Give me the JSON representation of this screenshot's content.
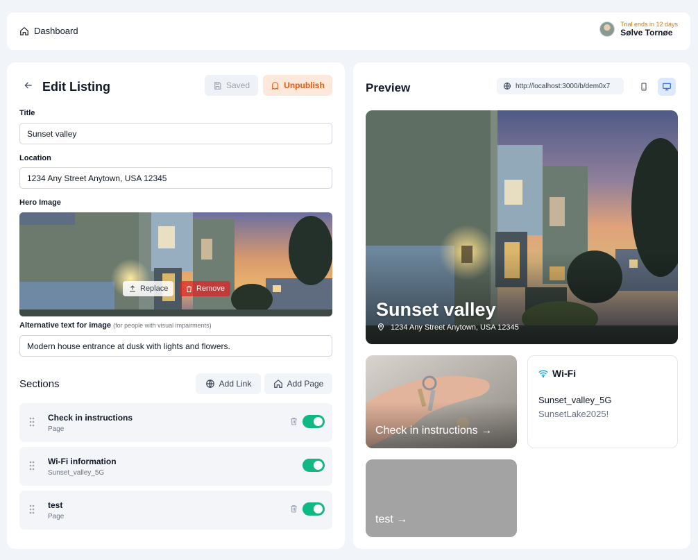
{
  "topbar": {
    "dashboard_label": "Dashboard",
    "trial_text": "Trial ends in 12 days",
    "user_name": "Sølve Tornøe"
  },
  "editor": {
    "title": "Edit Listing",
    "saved_label": "Saved",
    "unpublish_label": "Unpublish",
    "title_label": "Title",
    "title_value": "Sunset valley",
    "location_label": "Location",
    "location_value": "1234 Any Street Anytown, USA 12345",
    "hero_label": "Hero Image",
    "replace_label": "Replace",
    "remove_label": "Remove",
    "alt_label": "Alternative text for image",
    "alt_hint": "(for people with visual impairments)",
    "alt_value": "Modern house entrance at dusk with lights and flowers."
  },
  "sections": {
    "heading": "Sections",
    "add_link_label": "Add Link",
    "add_page_label": "Add Page",
    "items": [
      {
        "title": "Check in instructions",
        "subtitle": "Page",
        "deletable": true,
        "enabled": true
      },
      {
        "title": "Wi-Fi information",
        "subtitle": "Sunset_valley_5G",
        "deletable": false,
        "enabled": true
      },
      {
        "title": "test",
        "subtitle": "Page",
        "deletable": true,
        "enabled": true
      }
    ]
  },
  "preview": {
    "heading": "Preview",
    "url": "http://localhost:3000/b/dem0x7",
    "hero_title": "Sunset valley",
    "hero_location": "1234 Any Street Anytown, USA 12345",
    "card_checkin": "Check in instructions →",
    "card_test": "test →",
    "wifi_title": "Wi-Fi",
    "wifi_ssid": "Sunset_valley_5G",
    "wifi_password": "SunsetLake2025!"
  },
  "colors": {
    "accent_green": "#10b981",
    "unpublish_orange": "#ea580c",
    "trial_amber": "#d97706"
  }
}
